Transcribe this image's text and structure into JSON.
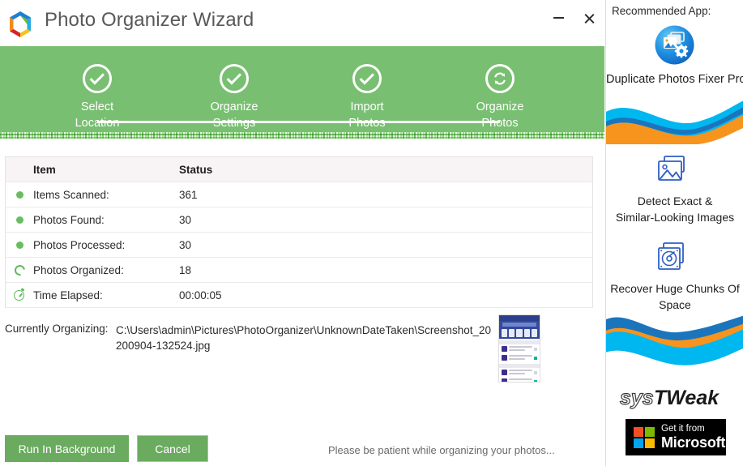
{
  "window": {
    "title": "Photo Organizer Wizard",
    "logo_icon": "systweak-hex-logo",
    "minimize_label": "—",
    "close_label": "✕",
    "accent_green": "#78bf71",
    "button_green": "#6aab5f"
  },
  "stepper": {
    "steps": [
      {
        "line1": "Select",
        "line2": "Location",
        "icon": "check-icon",
        "state": "done"
      },
      {
        "line1": "Organize",
        "line2": "Settings",
        "icon": "check-icon",
        "state": "done"
      },
      {
        "line1": "Import",
        "line2": "Photos",
        "icon": "check-icon",
        "state": "done"
      },
      {
        "line1": "Organize",
        "line2": "Photos",
        "icon": "refresh-icon",
        "state": "active"
      }
    ]
  },
  "table": {
    "headers": {
      "item": "Item",
      "status": "Status"
    },
    "rows": [
      {
        "icon": "green-dot-icon",
        "item": "Items Scanned:",
        "status": "361"
      },
      {
        "icon": "green-dot-icon",
        "item": "Photos Found:",
        "status": "30"
      },
      {
        "icon": "green-dot-icon",
        "item": "Photos Processed:",
        "status": "30"
      },
      {
        "icon": "spinner-icon",
        "item": "Photos Organized:",
        "status": "18"
      },
      {
        "icon": "stopwatch-icon",
        "item": "Time Elapsed:",
        "status": "00:00:05"
      }
    ]
  },
  "current": {
    "label": "Currently Organizing:",
    "path": "C:\\Users\\admin\\Pictures\\PhotoOrganizer\\UnknownDateTaken\\Screenshot_20200904-132524.jpg",
    "thumbnail_icon": "photo-thumbnail-preview"
  },
  "footer": {
    "run_background_label": "Run In Background",
    "cancel_label": "Cancel",
    "status_text": "Please be patient while organizing your photos..."
  },
  "sidebar": {
    "heading": "Recommended App:",
    "promo_icon": "duplicate-photos-fixer-icon",
    "promo_title": "Duplicate Photos Fixer Pro",
    "features": [
      {
        "icon": "images-stack-icon",
        "line1": "Detect Exact &",
        "line2": "Similar-Looking Images"
      },
      {
        "icon": "disk-stack-icon",
        "line1": "Recover Huge Chunks Of",
        "line2": "Space"
      }
    ],
    "brand": {
      "part1": "sys",
      "part2": "Tweak"
    },
    "store_badge": {
      "small": "Get it from",
      "big": "Microsoft",
      "icon": "microsoft-logo-icon"
    }
  }
}
